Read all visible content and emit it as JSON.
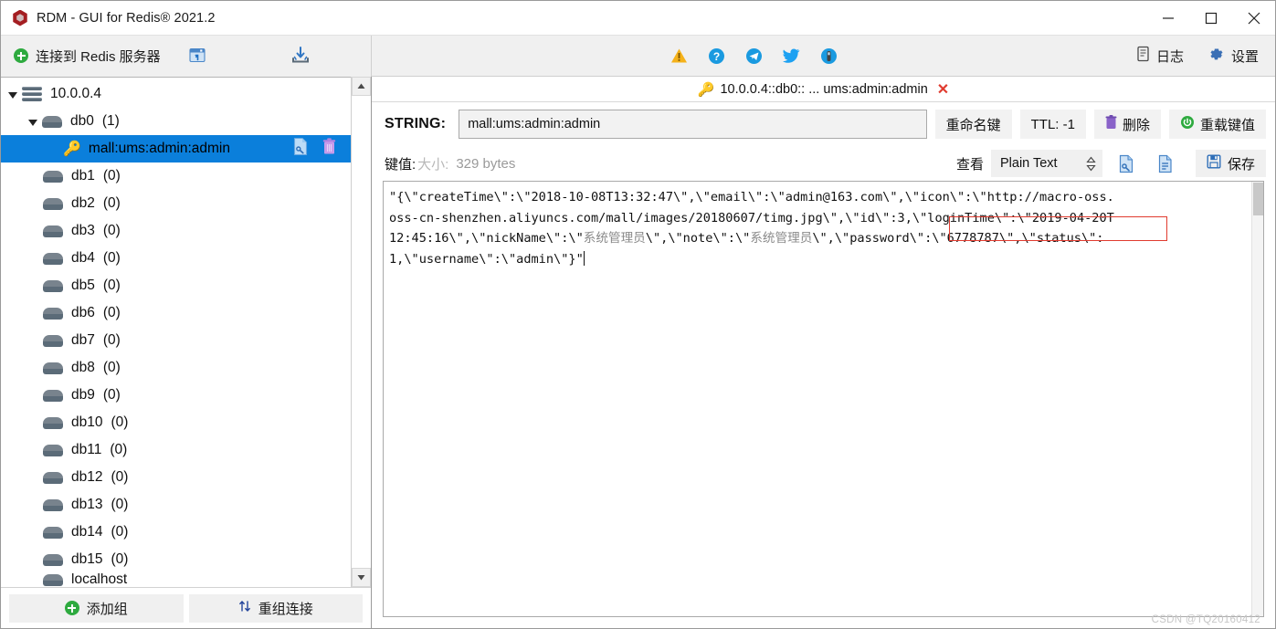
{
  "window": {
    "title": "RDM - GUI for Redis® 2021.2",
    "app_icon": "redis-hexagon-icon",
    "controls": {
      "minimize": "minimize-icon",
      "maximize": "maximize-icon",
      "close": "close-icon"
    }
  },
  "toolbar": {
    "connect_label": "连接到 Redis 服务器",
    "import_icon": "import-connections-icon",
    "download_icon": "download-icon",
    "center_icons": [
      {
        "name": "warning-icon",
        "glyph": "⚠",
        "color": "#f0ad21"
      },
      {
        "name": "help-icon",
        "glyph": "?",
        "color": "#1a9ae0"
      },
      {
        "name": "telegram-icon",
        "glyph": "➤",
        "color": "#1a9ae0"
      },
      {
        "name": "twitter-icon",
        "glyph": "🐦",
        "color": "#1da1f2"
      },
      {
        "name": "support-icon",
        "glyph": "◉",
        "color": "#1a9ae0"
      }
    ],
    "log_label": "日志",
    "log_icon": "log-icon",
    "settings_label": "设置",
    "settings_icon": "gear-icon"
  },
  "sidebar": {
    "tree": [
      {
        "label": "10.0.0.4",
        "count": "",
        "type": "server",
        "indent": 0,
        "expanded": true,
        "selected": false
      },
      {
        "label": "db0",
        "count": "(1)",
        "type": "db",
        "indent": 1,
        "expanded": true,
        "selected": false
      },
      {
        "label": "mall:ums:admin:admin",
        "count": "",
        "type": "key",
        "indent": 2,
        "expanded": false,
        "selected": true
      },
      {
        "label": "db1",
        "count": "(0)",
        "type": "db",
        "indent": 1,
        "expanded": false,
        "selected": false
      },
      {
        "label": "db2",
        "count": "(0)",
        "type": "db",
        "indent": 1,
        "expanded": false,
        "selected": false
      },
      {
        "label": "db3",
        "count": "(0)",
        "type": "db",
        "indent": 1,
        "expanded": false,
        "selected": false
      },
      {
        "label": "db4",
        "count": "(0)",
        "type": "db",
        "indent": 1,
        "expanded": false,
        "selected": false
      },
      {
        "label": "db5",
        "count": "(0)",
        "type": "db",
        "indent": 1,
        "expanded": false,
        "selected": false
      },
      {
        "label": "db6",
        "count": "(0)",
        "type": "db",
        "indent": 1,
        "expanded": false,
        "selected": false
      },
      {
        "label": "db7",
        "count": "(0)",
        "type": "db",
        "indent": 1,
        "expanded": false,
        "selected": false
      },
      {
        "label": "db8",
        "count": "(0)",
        "type": "db",
        "indent": 1,
        "expanded": false,
        "selected": false
      },
      {
        "label": "db9",
        "count": "(0)",
        "type": "db",
        "indent": 1,
        "expanded": false,
        "selected": false
      },
      {
        "label": "db10",
        "count": "(0)",
        "type": "db",
        "indent": 1,
        "expanded": false,
        "selected": false
      },
      {
        "label": "db11",
        "count": "(0)",
        "type": "db",
        "indent": 1,
        "expanded": false,
        "selected": false
      },
      {
        "label": "db12",
        "count": "(0)",
        "type": "db",
        "indent": 1,
        "expanded": false,
        "selected": false
      },
      {
        "label": "db13",
        "count": "(0)",
        "type": "db",
        "indent": 1,
        "expanded": false,
        "selected": false
      },
      {
        "label": "db14",
        "count": "(0)",
        "type": "db",
        "indent": 1,
        "expanded": false,
        "selected": false
      },
      {
        "label": "db15",
        "count": "(0)",
        "type": "db",
        "indent": 1,
        "expanded": false,
        "selected": false
      }
    ],
    "row_actions": {
      "edit_icon": "edit-key-icon",
      "delete_icon": "delete-key-icon"
    },
    "footer": {
      "add_group_label": "添加组",
      "add_group_icon": "plus-circle-icon",
      "regroup_label": "重组连接",
      "regroup_icon": "sort-arrows-icon"
    },
    "scroll": {
      "up_icon": "scroll-up-icon",
      "down_icon": "scroll-down-icon"
    }
  },
  "main": {
    "tab": {
      "key_icon": "key-icon",
      "label": "10.0.0.4::db0:: ... ums:admin:admin",
      "close_icon": "close-tab-icon"
    },
    "key_row": {
      "type_label": "STRING:",
      "key_value": "mall:ums:admin:admin",
      "rename_label": "重命名键",
      "ttl_label": "TTL: -1",
      "delete_label": "删除",
      "delete_icon": "trash-icon",
      "reload_label": "重载键值",
      "reload_icon": "reload-circle-icon"
    },
    "value_row": {
      "value_label": "键值:",
      "size_label": "大小:",
      "size_value": "329 bytes",
      "view_label": "查看",
      "view_selected": "Plain Text",
      "view_options": [
        "Plain Text"
      ],
      "format_icon": "format-json-icon",
      "wrap_icon": "text-document-icon",
      "save_label": "保存",
      "save_icon": "floppy-save-icon"
    },
    "editor": {
      "lines": [
        "\"{\\\"createTime\\\":\\\"2018-10-08T13:32:47\\\",\\\"email\\\":\\\"admin@163.com\\\",\\\"icon\\\":\\\"http://macro-oss.",
        "oss-cn-shenzhen.aliyuncs.com/mall/images/20180607/timg.jpg\\\",\\\"id\\\":3,\\\"loginTime\\\":\\\"2019-04-20T",
        "12:45:16\\\",\\\"nickName\\\":\\\"系统管理员\\\",\\\"note\\\":\\\"系统管理员\\\",\\\"password\\\":\\\"6778787\\\",\\\"status\\\":",
        "1,\\\"username\\\":\\\"admin\\\"}\""
      ],
      "annotation": {
        "name": "password-highlight-box",
        "color": "#e03b2f",
        "target_text": "\\\"password\\\":\\\"6778787\\\""
      }
    }
  },
  "watermark": "CSDN @TQ20160412"
}
